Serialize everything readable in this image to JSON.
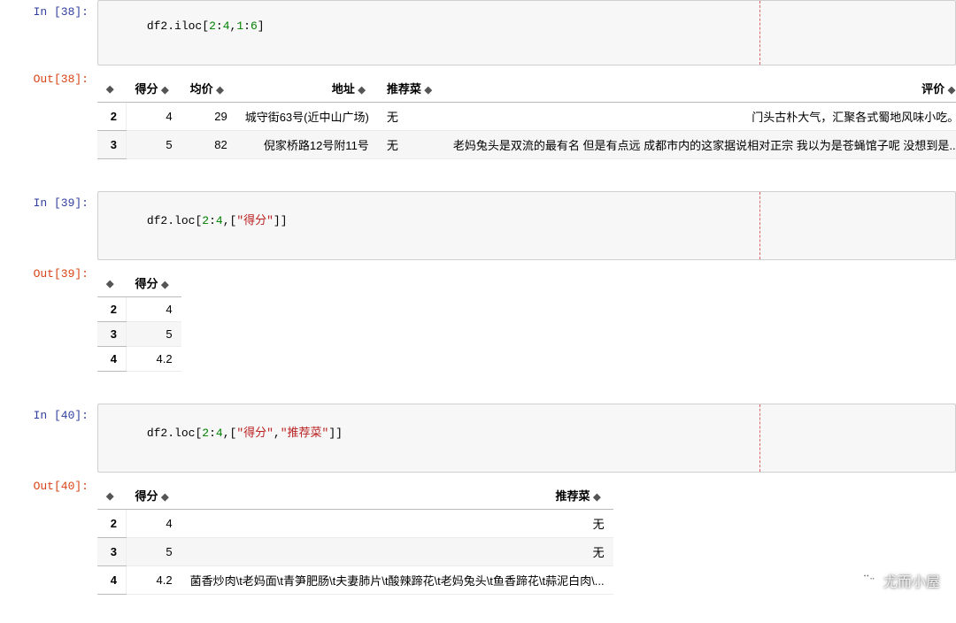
{
  "cells": {
    "c38": {
      "in_prompt": "In [38]:",
      "out_prompt": "Out[38]:",
      "code_parts": [
        "df2",
        ".",
        "iloc",
        "[",
        "2",
        ":",
        "4",
        ",",
        "1",
        ":",
        "6",
        "]"
      ],
      "code_types": [
        "ident",
        "punc",
        "ident",
        "brk",
        "num",
        "punc",
        "num",
        "punc",
        "num",
        "punc",
        "num",
        "brk"
      ],
      "table": {
        "headers": [
          "",
          "得分",
          "均价",
          "地址",
          "推荐菜",
          "评价"
        ],
        "header_align": [
          "right",
          "right",
          "right",
          "right",
          "left",
          "right"
        ],
        "rows": [
          {
            "idx": "2",
            "cells": [
              "4",
              "29",
              "城守街63号(近中山广场)",
              "无",
              "门头古朴大气，汇聚各式蜀地风味小吃。"
            ],
            "align": [
              "right",
              "right",
              "right",
              "left",
              "right"
            ]
          },
          {
            "idx": "3",
            "cells": [
              "5",
              "82",
              "倪家桥路12号附11号",
              "无",
              "老妈兔头是双流的最有名 但是有点远 成都市内的这家据说相对正宗 我以为是苍蝇馆子呢 没想到是..."
            ],
            "align": [
              "right",
              "right",
              "right",
              "left",
              "left"
            ]
          }
        ]
      }
    },
    "c39": {
      "in_prompt": "In [39]:",
      "out_prompt": "Out[39]:",
      "code_parts": [
        "df2",
        ".",
        "loc",
        "[",
        "2",
        ":",
        "4",
        ",",
        "[",
        "\"得分\"",
        "]",
        "]"
      ],
      "code_types": [
        "ident",
        "punc",
        "ident",
        "brk",
        "num",
        "punc",
        "num",
        "punc",
        "brk",
        "str",
        "brk",
        "brk"
      ],
      "table": {
        "headers": [
          "",
          "得分"
        ],
        "header_align": [
          "right",
          "right"
        ],
        "rows": [
          {
            "idx": "2",
            "cells": [
              "4"
            ],
            "align": [
              "right"
            ]
          },
          {
            "idx": "3",
            "cells": [
              "5"
            ],
            "align": [
              "right"
            ]
          },
          {
            "idx": "4",
            "cells": [
              "4.2"
            ],
            "align": [
              "right"
            ]
          }
        ]
      }
    },
    "c40": {
      "in_prompt": "In [40]:",
      "out_prompt": "Out[40]:",
      "code_parts": [
        "df2",
        ".",
        "loc",
        "[",
        "2",
        ":",
        "4",
        ",",
        "[",
        "\"得分\"",
        ",",
        "\"推荐菜\"",
        "]",
        "]"
      ],
      "code_types": [
        "ident",
        "punc",
        "ident",
        "brk",
        "num",
        "punc",
        "num",
        "punc",
        "brk",
        "str",
        "punc",
        "str",
        "brk",
        "brk"
      ],
      "table": {
        "headers": [
          "",
          "得分",
          "推荐菜"
        ],
        "header_align": [
          "right",
          "right",
          "right"
        ],
        "rows": [
          {
            "idx": "2",
            "cells": [
              "4",
              "无"
            ],
            "align": [
              "right",
              "right"
            ]
          },
          {
            "idx": "3",
            "cells": [
              "5",
              "无"
            ],
            "align": [
              "right",
              "right"
            ]
          },
          {
            "idx": "4",
            "cells": [
              "4.2",
              "菌香炒肉\\t老妈面\\t青笋肥肠\\t夫妻肺片\\t酸辣蹄花\\t老妈兔头\\t鱼香蹄花\\t蒜泥白肉\\..."
            ],
            "align": [
              "right",
              "left"
            ]
          }
        ]
      }
    }
  },
  "sort_glyph": "◆",
  "watermark": "尤而小屋",
  "wechat_icon_label": "wechat-icon"
}
